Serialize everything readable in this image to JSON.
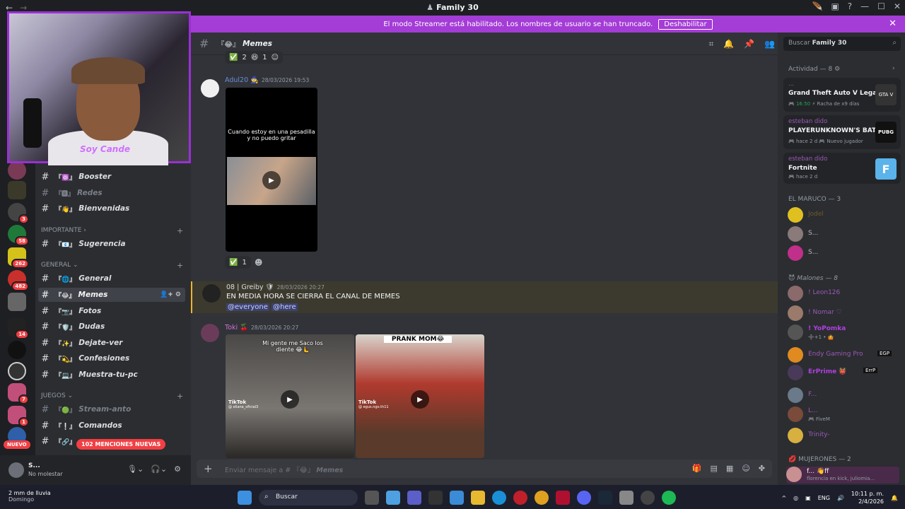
{
  "window": {
    "title": "Family 30",
    "nav_back": "←",
    "nav_fwd": "→"
  },
  "banner": {
    "text": "El modo Streamer está habilitado. Los nombres de usuario se han truncado.",
    "button": "Deshabilitar"
  },
  "servers": {
    "badges": [
      "3",
      "58",
      "262",
      "482",
      "14",
      "7",
      "1"
    ],
    "nuevo": "NUEVO",
    "mentions": "102 MENCIONES NUEVAS"
  },
  "webcam": {
    "overlay_text": "Soy Cande"
  },
  "channels": {
    "top": [
      {
        "emoji": "『⚛️』",
        "name": "Booster"
      },
      {
        "emoji": "『🆁』",
        "name": "Redes"
      },
      {
        "emoji": "『👋』",
        "name": "Bienvenidas"
      }
    ],
    "cat_importante": "IMPORTANTE",
    "importante": [
      {
        "emoji": "『📧』",
        "name": "Sugerencia"
      }
    ],
    "cat_general": "GENERAL",
    "general": [
      {
        "emoji": "『🌐』",
        "name": "General"
      },
      {
        "emoji": "『😂』",
        "name": "Memes"
      },
      {
        "emoji": "『📷』",
        "name": "Fotos"
      },
      {
        "emoji": "『🛡️』",
        "name": "Dudas"
      },
      {
        "emoji": "『✨』",
        "name": "Dejate-ver"
      },
      {
        "emoji": "『💫』",
        "name": "Confesiones"
      },
      {
        "emoji": "『💻』",
        "name": "Muestra-tu-pc"
      }
    ],
    "cat_juegos": "JUEGOS",
    "juegos": [
      {
        "emoji": "『🟢』",
        "name": "Stream-anto"
      },
      {
        "emoji": "『❕』",
        "name": "Comandos"
      },
      {
        "emoji": "『🔗』",
        "name": ""
      }
    ]
  },
  "user": {
    "name": "S...",
    "status": "No molestar"
  },
  "header": {
    "emoji": "『😂』",
    "channel": "Memes"
  },
  "messages": {
    "reactions_top": [
      {
        "emoji": "✅",
        "count": "2"
      },
      {
        "emoji": "😆",
        "count": "1"
      }
    ],
    "m1": {
      "author": "Adul20",
      "badge": "🧙",
      "time": "28/03/2026 19:53",
      "video_caption": "Cuando estoy en una pesadilla y no puedo gritar",
      "reaction": {
        "emoji": "✅",
        "count": "1"
      }
    },
    "m2": {
      "author": "08 | Greiby",
      "time": "28/03/2026 20:27",
      "text": "EN MEDIA HORA SE CIERRA EL CANAL DE MEMES",
      "mentions": [
        "@everyone",
        "@here"
      ]
    },
    "m3": {
      "author": "Toki",
      "badge": "🍒",
      "time": "28/03/2026 20:27",
      "video1_caption": "Mi gente me Saco los diente 😂🫷",
      "video2_caption": "PRANK MOM😂",
      "tiktok": "TikTok",
      "tiktok_user1": "@ eliana_oficial3",
      "tiktok_user2": "@ egus.ngo.th11"
    }
  },
  "composer": {
    "placeholder": "Enviar mensaje a #",
    "emoji": "『😂』",
    "channel": "Memes"
  },
  "right": {
    "search_prefix": "Buscar",
    "search_server": "Family 30",
    "activity_header": "Actividad — 8",
    "activities": [
      {
        "user": "...",
        "game": "Grand Theft Auto V Legacy",
        "meta1": "🎮 16:50",
        "meta2": "⚡ Racha de x9 días",
        "icon": "GTA V"
      },
      {
        "user": "esteban dido",
        "game": "PLAYERUNKNOWN'S BAT...",
        "meta1": "🎮 hace 2 d",
        "meta2": "🎮 Nuevo jugador",
        "icon": "PUBG"
      },
      {
        "user": "esteban dido",
        "game": "Fortnite",
        "meta1": "🎮 hace 2 d",
        "meta2": "",
        "icon": "F"
      }
    ],
    "group1": "EL MARUCO — 3",
    "group1_members": [
      "Jodel",
      "S...",
      "S..."
    ],
    "group2": "Malones — 8",
    "group2_members": [
      {
        "name": "! Leon126",
        "sub": ""
      },
      {
        "name": "! Nomar ♡",
        "sub": ""
      },
      {
        "name": "! YoPomka",
        "sub": "➕+1 • 🤷"
      },
      {
        "name": "Endy Gaming Pro",
        "sub": "",
        "tag": "EGP"
      },
      {
        "name": "ErPrime 👹",
        "sub": "",
        "tag": "ErrP"
      },
      {
        "name": "F...",
        "sub": ""
      },
      {
        "name": "L...",
        "sub": "🎮 FiveM"
      },
      {
        "name": "Trinity-",
        "sub": ""
      }
    ],
    "group3": "MUJERONES — 2",
    "group3_members": [
      {
        "name": "f... 👋ff",
        "sub": "florencia en kick, juliomia..."
      }
    ]
  },
  "taskbar": {
    "weather": "2 mm de lluvia",
    "day": "Domingo",
    "search": "Buscar",
    "lang": "ENG",
    "time": "10:11 p. m.",
    "date": "2/4/2026"
  }
}
